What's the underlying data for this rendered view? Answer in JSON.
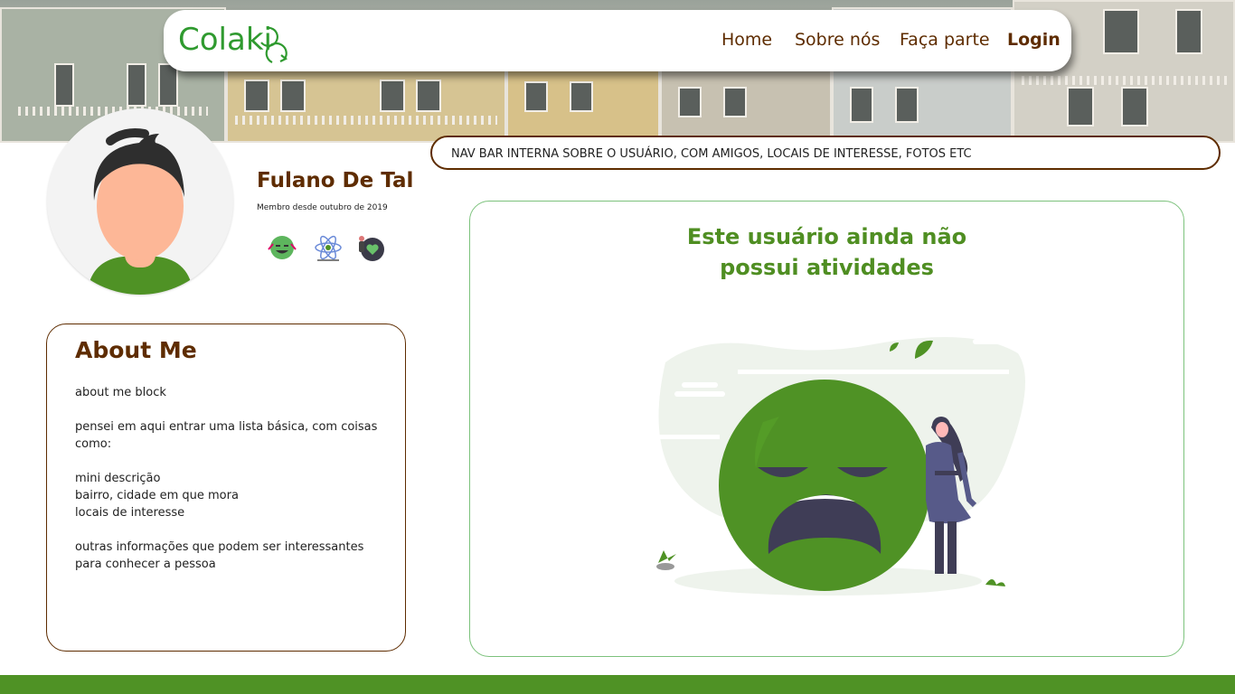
{
  "brand": {
    "logo_text": "Colaki",
    "logo_color": "#2f9a2f"
  },
  "navbar": {
    "items": [
      {
        "label": "Home"
      },
      {
        "label": "Sobre nós"
      },
      {
        "label": "Faça parte"
      },
      {
        "label": "Login"
      }
    ]
  },
  "profile": {
    "name": "Fulano De Tal",
    "member_since": "Membro desde outubro de 2019",
    "badges": [
      {
        "icon": "smiley-badge-icon"
      },
      {
        "icon": "atom-badge-icon"
      },
      {
        "icon": "heart-badge-icon"
      }
    ]
  },
  "inner_nav": {
    "text": "NAV BAR INTERNA SOBRE O USUÁRIO, COM AMIGOS, LOCAIS DE INTERESSE, FOTOS ETC"
  },
  "about": {
    "title": "About Me",
    "lines": [
      "about me block",
      "pensei em aqui entrar uma lista básica, com coisas",
      "como:",
      "mini descrição",
      "bairro, cidade em que mora",
      "locais de interesse",
      "outras informações que podem ser interessantes",
      "para conhecer a pessoa"
    ]
  },
  "activity": {
    "empty_title_line1": "Este usuário ainda não",
    "empty_title_line2": "possui atividades"
  },
  "colors": {
    "brown": "#5e2c00",
    "green": "#4f9225",
    "light_green_border": "#7cc27c"
  }
}
